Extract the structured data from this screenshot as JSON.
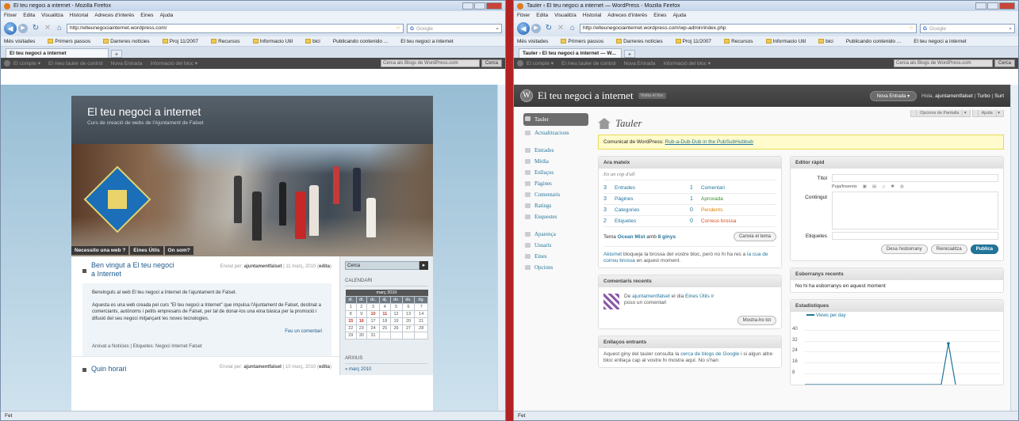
{
  "left": {
    "window_title": "El teu negoci a internet - Mozilla Firefox",
    "menu": [
      "Fitxer",
      "Edita",
      "Visualitza",
      "Historial",
      "Adreces d'interès",
      "Eines",
      "Ajuda"
    ],
    "url": "http://elteunegociainternet.wordpress.com/",
    "search_placeholder": "Google",
    "bookmarks": [
      "Més visitades",
      "Primers passos",
      "Darreres notícies",
      "Proj 11/2007",
      "Recursos",
      "Informacio Util",
      "bici",
      "Publicando contenido ...",
      "El teu negoci a internet"
    ],
    "tab": "El teu negoci a internet",
    "wpbar": [
      "El compte ▾",
      "El meu tauler de control",
      "Nova Entrada",
      "Informació del bloc ▾"
    ],
    "wpbar_search": "Cerca als Blogs de WordPress.com",
    "wpbar_search_btn": "Cerca",
    "blog_title": "El teu negoci a internet",
    "blog_subtitle": "Curs de creació de webs de l'Ajuntament de Falset",
    "image_nav": [
      "Necessito una web ?",
      "Eines Útils",
      "On som?"
    ],
    "post1": {
      "title": "Ben vingut a El teu negoci a Internet",
      "meta_prefix": "Enviat per:",
      "author": "ajuntamentfalset",
      "date": "11 març, 2010",
      "edit": "edita",
      "p1": "Benvinguts al web El teu negoci a Internet de l'ajuntament de Falset.",
      "p2": "Aquesta es una web creada pel curs \"El teu negoci a Internet\" que impulsa l'Ajuntament de Falset, destinat a comerciants, autònoms i petits empresaris de Falset, per tal de donar-los una eina bàsica per la promoció i difusió del seu negoci mitjançant les noves tecnologies.",
      "more": "Feu un comentari",
      "tags": "Arxivat a Notícies | Etiquetes: Negoci Internet Falset"
    },
    "post2": {
      "title": "Quin horari",
      "meta_prefix": "Enviat per:",
      "author": "ajuntamentfalset",
      "date": "10 març, 2010",
      "edit": "edita"
    },
    "sidebar": {
      "search": "Cerca",
      "calendar_title": "CALENDARI",
      "calendar_month": "març 2010",
      "days": [
        "dl.",
        "dt.",
        "dc.",
        "dj.",
        "dv.",
        "ds.",
        "dg."
      ],
      "weeks": [
        [
          "1",
          "2",
          "3",
          "4",
          "5",
          "6",
          "7"
        ],
        [
          "8",
          "9",
          "10",
          "11",
          "12",
          "13",
          "14"
        ],
        [
          "15",
          "16",
          "17",
          "18",
          "19",
          "20",
          "21"
        ],
        [
          "22",
          "23",
          "24",
          "25",
          "26",
          "27",
          "28"
        ],
        [
          "29",
          "30",
          "31",
          "",
          "",
          "",
          ""
        ]
      ],
      "archive_title": "ARXIUS",
      "archive_item": "» març 2010"
    },
    "status": "Fet"
  },
  "right": {
    "window_title": "Tauler ‹ El teu negoci a internet — WordPress - Mozilla Firefox",
    "menu": [
      "Fitxer",
      "Edita",
      "Visualitza",
      "Historial",
      "Adreces d'interès",
      "Eines",
      "Ajuda"
    ],
    "url": "http://elteunegociainternet.wordpress.com/wp-admin/index.php",
    "search_placeholder": "Google",
    "bookmarks": [
      "Més visitades",
      "Primers passos",
      "Darreres notícies",
      "Proj 11/2007",
      "Recursos",
      "Informacio Util",
      "bici",
      "Publicando contenido ...",
      "El teu negoci a internet"
    ],
    "tab": "Tauler ‹ El teu negoci a internet — W...",
    "wpbar": [
      "El compte ▾",
      "El meu tauler de control",
      "Nova Entrada",
      "Informació del bloc ▾"
    ],
    "wpbar_search": "Cerca als Blogs de WordPress.com",
    "wpbar_search_btn": "Cerca",
    "site_title": "El teu negoci a internet",
    "visit_site": "Visita el lloc",
    "new_entry": "Nova Entrada",
    "howdy": "Hola,",
    "user": "ajuntamentfalset",
    "turbo": "Turbo",
    "logout": "Surt",
    "screen_options": "Opcions de Pantalla",
    "help": "Ajuda",
    "menu_items": [
      "Tauler",
      "Actualitzacions",
      "Entrades",
      "Mèdia",
      "Enllaços",
      "Pàgines",
      "Comentaris",
      "Ratings",
      "Enquestes",
      "Aparença",
      "Usuaris",
      "Eines",
      "Opcions"
    ],
    "page_title": "Tauler",
    "notice_prefix": "Comunicat de WordPress:",
    "notice_link": "Rub-a-Dub-Dub in the PubSubHubbub",
    "right_now": {
      "title": "Ara mateix",
      "sub": "En un cop d'ull",
      "left": [
        {
          "n": "3",
          "l": "Entrades"
        },
        {
          "n": "3",
          "l": "Pàgines"
        },
        {
          "n": "3",
          "l": "Categories"
        },
        {
          "n": "2",
          "l": "Etiquetes"
        }
      ],
      "right": [
        {
          "n": "1",
          "l": "Comentari"
        },
        {
          "n": "1",
          "l": "Aprovada"
        },
        {
          "n": "0",
          "l": "Pendents"
        },
        {
          "n": "0",
          "l": "Correus brossa"
        }
      ],
      "theme_prefix": "Tema",
      "theme": "Ocean Mist",
      "theme_mid": "amb",
      "widgets": "8 ginys",
      "change_theme": "Canvia el tema",
      "akismet": "Akismet",
      "akismet_text": "bloqueja la brossa del vostre bloc, però no hi ha res a",
      "akismet_link": "la cua de correu brossa",
      "akismet_end": "en aquest moment."
    },
    "recent_comments": {
      "title": "Comentaris recents",
      "from": "De",
      "author": "ajuntamentfalset",
      "on": "el dia",
      "post": "Eines Útils #",
      "text": "poso un comentari",
      "show_all": "Mostra-ho tot"
    },
    "incoming": {
      "title": "Enllaços entrants",
      "text1": "Aquest giny del tauler consulta la",
      "link": "cerca de blogs de Google",
      "text2": "i si algun altre bloc enllaça cap al vostre hi mostra aquí. No s'han"
    },
    "quickpress": {
      "title": "Editor ràpid",
      "f_title": "Títol",
      "upload": "Puja/Insereix",
      "f_content": "Contingut",
      "f_tags": "Etiquetes",
      "save": "Desa l'esborrany",
      "reset": "Reinicialitza",
      "publish": "Publica"
    },
    "drafts": {
      "title": "Esborranys recents",
      "text": "No hi ha esborranys en aquest moment"
    },
    "stats": {
      "title": "Estadístiques",
      "legend": "Views per day"
    },
    "status": "Fet"
  },
  "chart_data": {
    "type": "line",
    "series": [
      {
        "name": "Views per day",
        "values": [
          0,
          0,
          0,
          0,
          0,
          0,
          0,
          0,
          0,
          0,
          0,
          0,
          0,
          0,
          0,
          0,
          0,
          0,
          0,
          0,
          30,
          0
        ]
      }
    ],
    "yticks": [
      40,
      32,
      24,
      16,
      8
    ],
    "ylim": [
      0,
      45
    ]
  }
}
